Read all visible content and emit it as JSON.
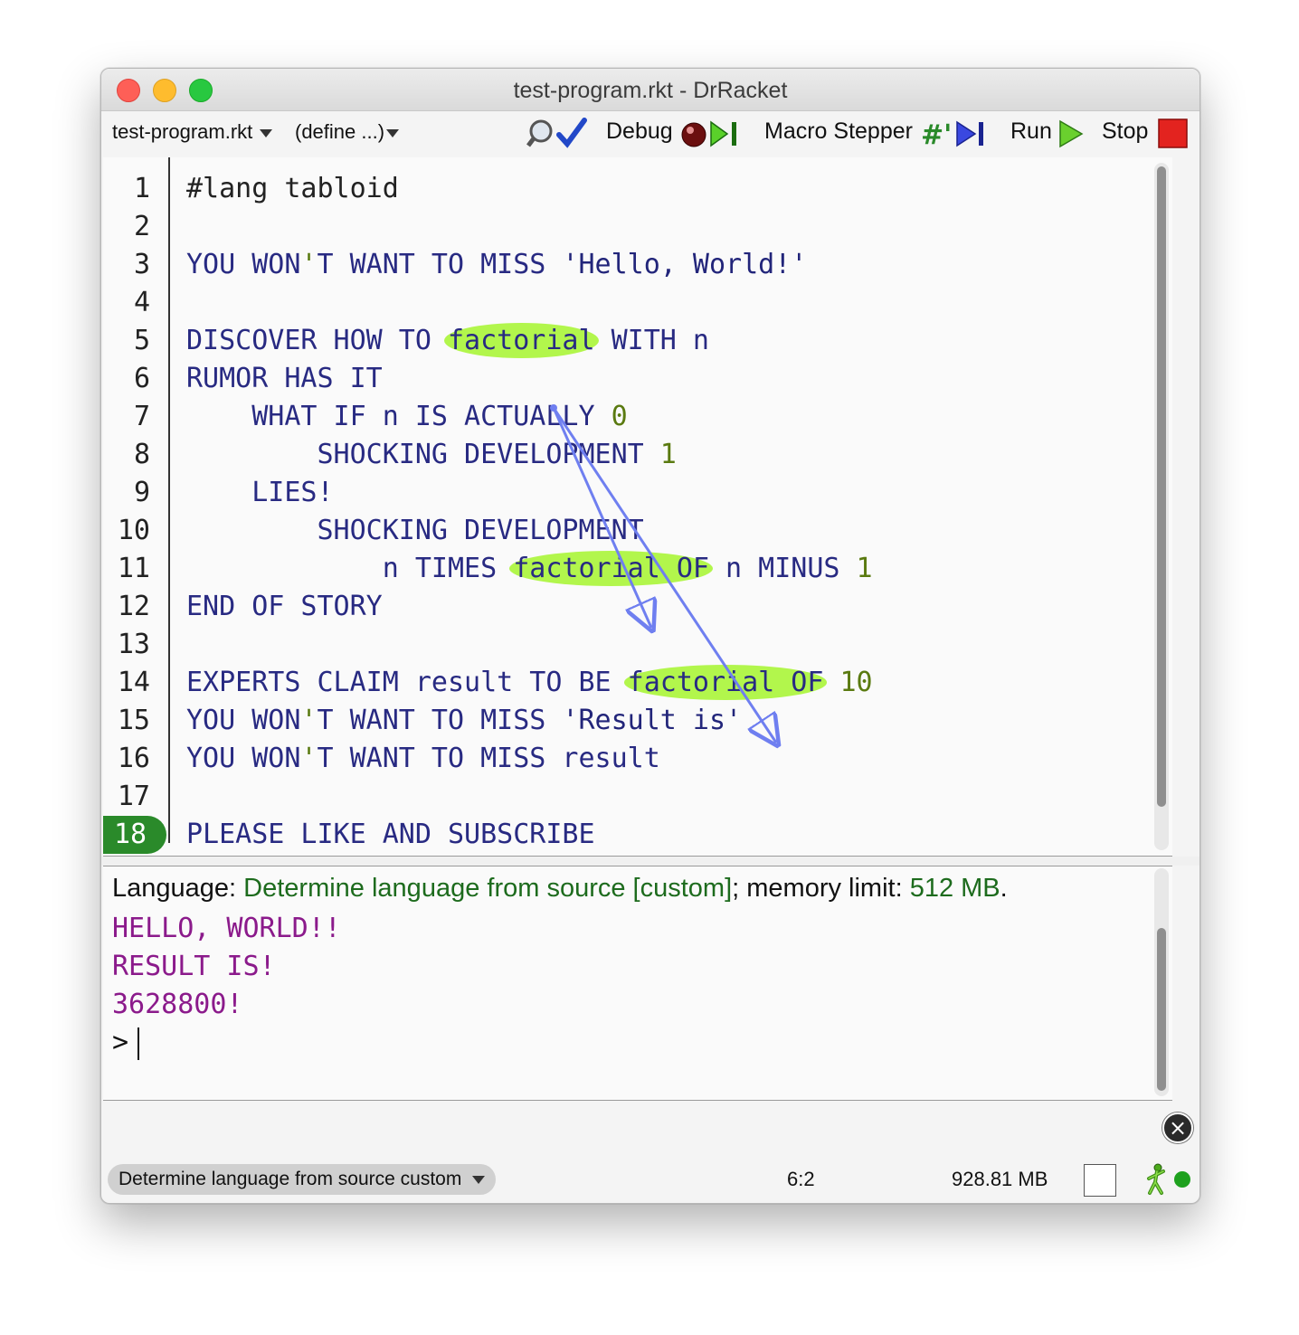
{
  "window": {
    "title": "test-program.rkt - DrRacket"
  },
  "toolbar": {
    "file_menu": "test-program.rkt",
    "define_menu": "(define ...)",
    "debug_label": "Debug",
    "macro_stepper_label": "Macro Stepper",
    "run_label": "Run",
    "stop_label": "Stop"
  },
  "editor": {
    "line_numbers": [
      "1",
      "2",
      "3",
      "4",
      "5",
      "6",
      "7",
      "8",
      "9",
      "10",
      "11",
      "12",
      "13",
      "14",
      "15",
      "16",
      "17",
      "18"
    ],
    "active_line": "18",
    "lines": {
      "l1": "#lang tabloid",
      "l3a": "YOU WON",
      "l3b": "'",
      "l3c": "T WANT TO MISS ",
      "l3d": "'Hello, World!'",
      "l5a": "DISCOVER HOW TO ",
      "l5b": "factorial",
      "l5c": " WITH n",
      "l6": "RUMOR HAS IT",
      "l7a": "    WHAT IF n IS ACTUALLY ",
      "l7b": "0",
      "l8a": "        SHOCKING DEVELOPMENT ",
      "l8b": "1",
      "l9": "    LIES!",
      "l10": "        SHOCKING DEVELOPMENT",
      "l11a": "            n TIMES ",
      "l11b": "factorial OF",
      "l11c": " n MINUS ",
      "l11d": "1",
      "l12": "END OF STORY",
      "l14a": "EXPERTS CLAIM result TO BE ",
      "l14b": "factorial OF",
      "l14c": " ",
      "l14d": "10",
      "l15a": "YOU WON",
      "l15b": "'",
      "l15c": "T WANT TO MISS ",
      "l15d": "'Result is'",
      "l16a": "YOU WON",
      "l16b": "'",
      "l16c": "T WANT TO MISS result",
      "l18": "PLEASE LIKE AND SUBSCRIBE"
    }
  },
  "repl": {
    "lang_prefix": "Language: ",
    "lang_value": "Determine language from source [custom]",
    "lang_mid": "; memory limit: ",
    "mem_value": "512 MB",
    "lang_end": ".",
    "output": [
      "HELLO, WORLD!!",
      "RESULT IS!",
      "3628800!"
    ],
    "prompt": ">"
  },
  "status": {
    "language": "Determine language from source custom",
    "position": "6:2",
    "memory": "928.81 MB"
  },
  "colors": {
    "keyword": "#282a82",
    "number": "#5a7a10",
    "highlight": "#b2f64c",
    "output": "#8b1a8b",
    "language_green": "#1d6b1d",
    "arrow": "#6f7ff0"
  }
}
